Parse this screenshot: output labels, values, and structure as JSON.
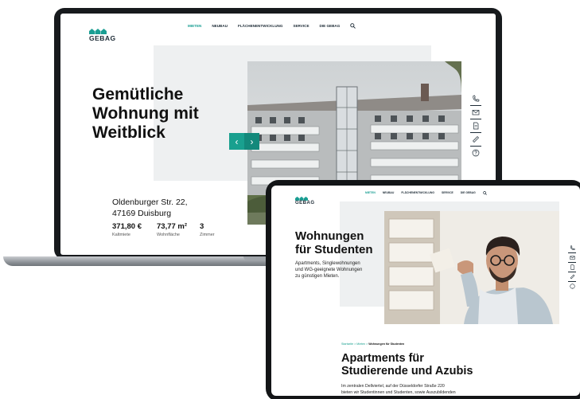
{
  "brand": {
    "name": "GEBAG",
    "color": "#1a9e93"
  },
  "laptop": {
    "nav": {
      "items": [
        "MIETEN",
        "NEUBAU",
        "FLÄCHENENTWICKLUNG",
        "SERVICE",
        "DIE GEBAG"
      ],
      "active": "MIETEN",
      "search_icon": "search-icon"
    },
    "hero": {
      "title_lines": [
        "Gemütliche",
        "Wohnung mit",
        "Weitblick"
      ]
    },
    "address": {
      "line1": "Oldenburger Str. 22,",
      "line2": "47169 Duisburg"
    },
    "facts": [
      {
        "value": "371,80 €",
        "label": "Kaltmiete"
      },
      {
        "value": "73,77 m²",
        "label": "Wohnfläche"
      },
      {
        "value": "3",
        "label": "Zimmer"
      }
    ],
    "carousel": {
      "prev": "‹",
      "next": "›"
    },
    "side_icons": [
      "phone-icon",
      "mail-icon",
      "document-icon",
      "ruler-icon",
      "help-icon"
    ]
  },
  "tablet": {
    "nav": {
      "items": [
        "MIETEN",
        "NEUBAU",
        "FLÄCHENENTWICKLUNG",
        "SERVICE",
        "DIE GEBAG"
      ],
      "active": "MIETEN",
      "search_icon": "search-icon"
    },
    "hero": {
      "title_lines": [
        "Wohnungen",
        "für Studenten"
      ],
      "subtitle_lines": [
        "Apartments, Singlewohnungen",
        "und WG-geeignete Wohnungen",
        "zu günstigen Mieten."
      ]
    },
    "breadcrumb": {
      "items": [
        "Startseite",
        "Mieten"
      ],
      "current": "Wohnungen für Studenten",
      "separator": ">"
    },
    "section": {
      "title_lines": [
        "Apartments für",
        "Studierende und Azubis"
      ],
      "body_lines": [
        "Im zentralen Dellviertel, auf der Düsseldorfer Straße 220",
        "bieten wir Studentinnen und Studenten, sowie Auszubildenden"
      ]
    },
    "side_icons": [
      "phone-icon",
      "mail-icon",
      "document-icon",
      "ruler-icon",
      "help-icon"
    ]
  }
}
